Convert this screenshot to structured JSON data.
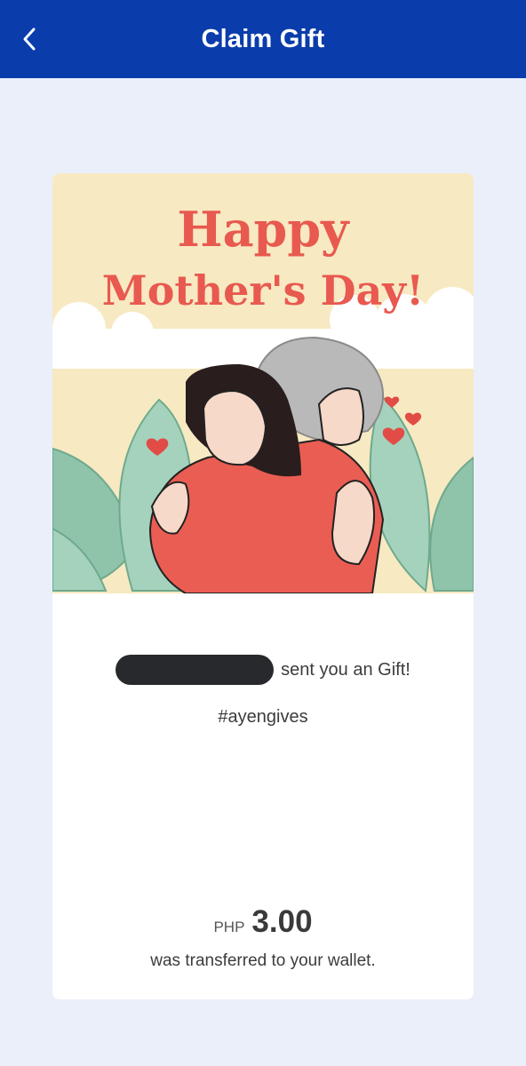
{
  "header": {
    "title": "Claim Gift",
    "back_icon": "chevron-left-icon"
  },
  "gift_card": {
    "greeting_line1": "Happy",
    "greeting_line2": "Mother's Day!",
    "sent_text": "sent you an Gift!",
    "hashtag": "#ayengives",
    "currency": "PHP",
    "amount": "3.00",
    "transfer_note": "was transferred to your wallet."
  },
  "colors": {
    "header_bg": "#0a3dab",
    "page_bg": "#eaeffa",
    "card_art_bg": "#f7e9c2",
    "greeting_text": "#e8594f",
    "leaf": "#8fc4ab",
    "sweater": "#ea5d53"
  }
}
